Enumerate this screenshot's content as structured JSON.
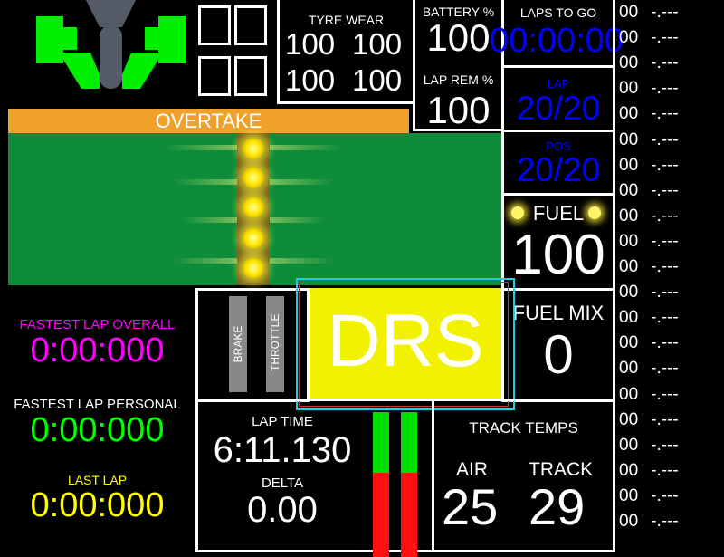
{
  "tyre_wear": {
    "label": "TYRE WEAR",
    "fl": "100",
    "fr": "100",
    "rl": "100",
    "rr": "100"
  },
  "battery": {
    "label": "BATTERY %",
    "value": "100"
  },
  "lap_rem": {
    "label": "LAP REM %",
    "value": "100"
  },
  "laps_to_go": {
    "label": "LAPS TO GO",
    "value": "00:00:00"
  },
  "lap": {
    "label": "LAP",
    "value": "20/20"
  },
  "pos": {
    "label": "POS",
    "value": "20/20"
  },
  "fuel": {
    "label": "FUEL",
    "value": "100"
  },
  "fuel_mix": {
    "label": "FUEL MIX",
    "value": "0"
  },
  "overtake": {
    "label": "OVERTAKE"
  },
  "drs": {
    "label": "DRS"
  },
  "pedals": {
    "brake_label": "BRAKE",
    "throttle_label": "THROTTLE"
  },
  "fastest_lap_overall": {
    "label": "FASTEST LAP OVERALL",
    "value": "0:00:000"
  },
  "fastest_lap_personal": {
    "label": "FASTEST LAP PERSONAL",
    "value": "0:00:000"
  },
  "last_lap": {
    "label": "LAST LAP",
    "value": "0:00:000"
  },
  "lap_time": {
    "label": "LAP TIME",
    "value": "6:11.130"
  },
  "delta": {
    "label": "DELTA",
    "value": "0.00"
  },
  "track_temps": {
    "label": "TRACK TEMPS",
    "air_label": "AIR",
    "air_value": "25",
    "track_label": "TRACK",
    "track_value": "29"
  },
  "lap_list": [
    {
      "num": "00",
      "time": "-.---"
    },
    {
      "num": "00",
      "time": "-.---"
    },
    {
      "num": "00",
      "time": "-.---"
    },
    {
      "num": "00",
      "time": "-.---"
    },
    {
      "num": "00",
      "time": "-.---"
    },
    {
      "num": "00",
      "time": "-.---"
    },
    {
      "num": "00",
      "time": "-.---"
    },
    {
      "num": "00",
      "time": "-.---"
    },
    {
      "num": "00",
      "time": "-.---"
    },
    {
      "num": "00",
      "time": "-.---"
    },
    {
      "num": "00",
      "time": "-.---"
    },
    {
      "num": "00",
      "time": "-.---"
    },
    {
      "num": "00",
      "time": "-.---"
    },
    {
      "num": "00",
      "time": "-.---"
    },
    {
      "num": "00",
      "time": "-.---"
    },
    {
      "num": "00",
      "time": "-.---"
    },
    {
      "num": "00",
      "time": "-.---"
    },
    {
      "num": "00",
      "time": "-.---"
    },
    {
      "num": "00",
      "time": "-.---"
    },
    {
      "num": "00",
      "time": "-.---"
    },
    {
      "num": "00",
      "time": "-.---"
    }
  ],
  "colors": {
    "magenta": "#ff00ff",
    "green": "#00ff00",
    "yellow": "#ffff00",
    "blue": "#0000ff",
    "drs_yellow": "#f2f200",
    "overtake_orange": "#f0a12b",
    "panel_green": "#0d8c3a"
  }
}
